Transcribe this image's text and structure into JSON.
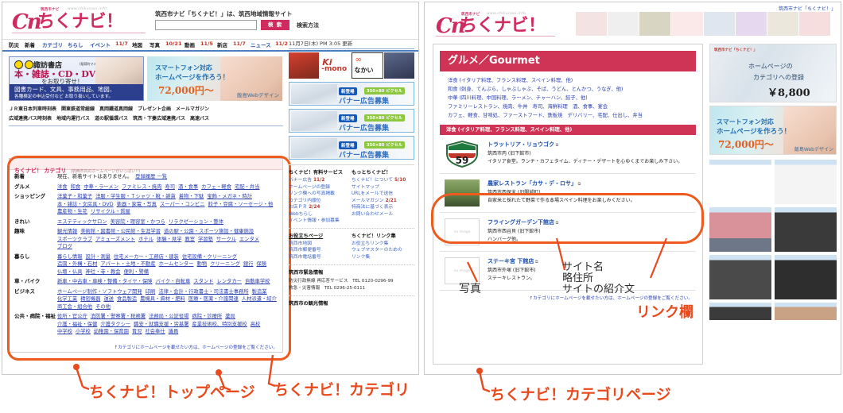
{
  "branding": {
    "logo_sub": "筑西市ナビ",
    "logo_url": "www.chikunavi.info",
    "logo_cn": "Cn",
    "logo_main": "ちくナビ！",
    "tagline": "筑西市ナビ「ちくナビ！」は、筑西地域情報サイト",
    "corner_tag": "筑西市ナビ「ちくナビ！」"
  },
  "search": {
    "value": "",
    "placeholder": "",
    "button": "検 索",
    "howto": "検索方法"
  },
  "nav": [
    {
      "label": "防災",
      "date": ""
    },
    {
      "label": "新着",
      "date": ""
    },
    {
      "label": "カテゴリ",
      "date": ""
    },
    {
      "label": "ちらし",
      "date": ""
    },
    {
      "label": "イベント",
      "date": "11/7"
    },
    {
      "label": "地図",
      "date": ""
    },
    {
      "label": "写真",
      "date": "10/21"
    },
    {
      "label": "動画",
      "date": "11/5"
    },
    {
      "label": "新店",
      "date": "11/7"
    },
    {
      "label": "ニュース",
      "date": "11/2"
    }
  ],
  "banners": {
    "left": {
      "shop": "諏訪書店",
      "shop_note": "(稲荷町マスゼン)",
      "line1": "本・雑誌・CD・DVD",
      "line2": "をお取り寄せ！",
      "line3": "図書カード、文具、事務用品、地図、",
      "line4": "各種検定の申込受付など お取り扱いしています。"
    },
    "right": {
      "line1": "スマートフォン対応",
      "line2": "ホームページを作ろう！",
      "price": "72,000円～",
      "credit": "飯島Webデザイン"
    }
  },
  "jr_links_row1": "ＪＲ東日本列車時刻表　関東鉄道常総線　真岡鐵道真岡線　プレゼント企画　メールマガジン",
  "jr_links_row2": "広域連携バス時刻表　地域内運行バス　道の駅循環バス　筑西・下妻広域連携バス　高速バス",
  "category_box": {
    "title": "ちくナビ！ カテゴリ",
    "title_note": "(筑西市内のホームページがいっぱい!!)",
    "footer": "↑カテゴリにホームページを載せたい方は、ホームページの登録をご覧ください。",
    "rows": [
      {
        "key": "新着",
        "lines": [
          [
            "現在、新着サイトはありません。",
            "登録履歴 一覧"
          ]
        ]
      },
      {
        "key": "グルメ",
        "lines": [
          [
            "洋食",
            "和食",
            "中華・ラーメン",
            "ファミレス・焼肉",
            "寿司",
            "酒・食事",
            "カフェ・軽食",
            "宅配・弁当"
          ]
        ]
      },
      {
        "key": "ショッピング",
        "lines": [
          [
            "洋菓子・和菓子",
            "洋服・学生服・Ｔシャツ・靴・雑貨",
            "着物・下駄",
            "宝飾・メガネ・時計"
          ],
          [
            "本・雑誌・文房具・DVD",
            "楽器・家電・写真",
            "スーパー・コンビニ",
            "餃子・豆腐・ソーセージ・他"
          ],
          [
            "農産物・生花",
            "リサイクル・質屋"
          ]
        ]
      },
      {
        "key": "きれい",
        "lines": [
          [
            "エステティックサロン",
            "美容院・理容室・かつら",
            "リラクゼーション・整体"
          ]
        ]
      },
      {
        "key": "趣味",
        "lines": [
          [
            "観光情報",
            "美術館・図書館・公民館・生涯学習",
            "道の駅・公園・スポーツ施設・健康施設"
          ],
          [
            "スポーツクラブ",
            "アミューズメント",
            "ホテル",
            "体験・見学",
            "教室",
            "学習塾",
            "サークル",
            "エンタメ"
          ],
          [
            "ブログ"
          ]
        ]
      },
      {
        "key": "暮らし",
        "lines": [
          [
            "暮らし情報",
            "設計・測量",
            "住宅メーカー・工務店・建装",
            "住宅設備・クリーニング"
          ],
          [
            "造園・外構・石材",
            "アパート・土地・不動産",
            "ホームセンター",
            "動物",
            "クリーニング",
            "銀行",
            "保険"
          ],
          [
            "仏壇・仏具",
            "神社・寺・教会",
            "便利・警備"
          ]
        ]
      },
      {
        "key": "車・バイク",
        "lines": [
          [
            "新車・中古車・車検・整備・タイヤ・保険",
            "バイク・自転車",
            "スタンド",
            "レンタカー",
            "自動車学校"
          ]
        ]
      },
      {
        "key": "ビジネス",
        "lines": [
          [
            "ホームページ制作・ソフトウェア開発",
            "印刷",
            "法律・会計・行政書士・司法書士事務所",
            "製造業"
          ],
          [
            "化学工業",
            "精密機器",
            "運送",
            "食品製造",
            "農機具・資材・肥料",
            "医療・医薬・介護関連",
            "人材派遣・紹介"
          ],
          [
            "商工会・組合他",
            "その他"
          ]
        ]
      },
      {
        "key": "公共・病院・福祉",
        "lines": [
          [
            "役所・官公庁",
            "消防署・警察署・税務署",
            "法務局・公証役場",
            "病院・診療所",
            "薬局"
          ],
          [
            "介護・福祉・保健",
            "介護タクシー",
            "職安・就職支援・労基署",
            "産業技術校、特別支援校",
            "高校"
          ],
          [
            "中学校",
            "小学校",
            "幼稚園・保育園",
            "育児",
            "社会奉仕",
            "議員"
          ]
        ]
      }
    ]
  },
  "left_sidebar": {
    "updated": "11月7日(木) PM 3:05 更新",
    "ad_banners": [
      {
        "new_tag": "新登場",
        "px_tag": "350×80 ピクセル",
        "text": "バナー広告募集"
      },
      {
        "new_tag": "新登場",
        "px_tag": "350×80 ピクセル",
        "text": "バナー広告募集"
      },
      {
        "new_tag": "新登場",
        "px_tag": "350×80 ピクセル",
        "text": "バナー広告募集"
      }
    ],
    "col_left": {
      "heading": "ちくナビ！有料サービス",
      "items": [
        {
          "label": "バナー広告",
          "date": "11/2"
        },
        {
          "label": "ホームページの登録",
          "date": ""
        },
        {
          "label": "リンク欄への写真掲載",
          "date": ""
        },
        {
          "label": "カテゴリ内順位",
          "date": ""
        },
        {
          "label": "お店ＰＲ",
          "date": "2/24"
        },
        {
          "label": "Webちらし",
          "date": ""
        },
        {
          "label": "イベント情報・参加募集",
          "date": ""
        }
      ]
    },
    "col_right": {
      "heading": "もっとちくナビ！",
      "items": [
        {
          "label": "ちくナビ！について",
          "date": "5/10"
        },
        {
          "label": "サイトマップ",
          "date": ""
        },
        {
          "label": "URLをメールで送信",
          "date": ""
        },
        {
          "label": "メールマガジン",
          "date": "2/21"
        },
        {
          "label": "特商法に基づく表示",
          "date": ""
        },
        {
          "label": "お問い合わせメール",
          "date": ""
        }
      ]
    },
    "col_left2": {
      "heading": "お役立ちページ",
      "items": [
        {
          "label": "筑西市地図",
          "date": ""
        },
        {
          "label": "筑西市郵便番号",
          "date": ""
        },
        {
          "label": "筑西市電話番号",
          "date": ""
        }
      ]
    },
    "col_right2": {
      "heading": "ちくナビ！リンク集",
      "items": [
        {
          "label": "お役立ちリンク集",
          "date": ""
        },
        {
          "label": "ウェブマスターのための",
          "date": ""
        },
        {
          "label": "リンク集",
          "date": ""
        }
      ]
    },
    "emergency": {
      "heading": "筑西市緊急情報",
      "line1": "防災行政無線 再応答サービス　TEL 0120-0296-99",
      "line2": "救急・災害情報　TEL 0296-25-0111"
    },
    "tourism_heading": "筑西市の観光情報"
  },
  "gourmet": {
    "title": "グルメ／Gourmet",
    "links": [
      "洋食 (イタリア料理、フランス料理、スペイン料理、他)",
      "和食 (刺身、てんぷら、しゃぶしゃぶ、そば、うどん、とんかつ、うなぎ、他)",
      "中華 (四川料理、中国料理、ラーメン、チャーハン、餃子、他)",
      "ファミリーレストラン、焼肉、牛丼　寿司、海鮮料理　酒、食事、宴会",
      "カフェ、軽食、甘味処、ファーストフード、鉄板焼　デリバリー、宅配、仕出し、弁当"
    ],
    "subheading": "洋食 (イタリア料理、フランス料理、スペイン料理、他)",
    "entries": [
      {
        "thumb": "shield",
        "name": "トラットリア・リョウゴク",
        "ext_icon": "external-link",
        "address": "筑西市丙 (旧下館市)",
        "desc": "イタリア食堂。ランチ・カフェタイム、ディナー・デザートを心ゆくまでお楽しみ下さい。"
      },
      {
        "thumb": "photo",
        "name": "農家レストラン「カサ・デ・ロサ」",
        "ext_icon": "external-link",
        "address": "筑西市西保末 (旧関城町)",
        "desc": "自家米と採れたて野菜で作る本場スペイン料理をお楽しみください。"
      },
      {
        "thumb": "noimage",
        "thumb_label": "no image",
        "name": "フライングガーデン下館店",
        "ext_icon": "external-link",
        "address": "筑西市西谷貝 (旧下館市)",
        "desc": "ハンバーグ他。"
      },
      {
        "thumb": "noimage",
        "thumb_label": "no image",
        "name": "ステーキ宮 下館店",
        "ext_icon": "external-link",
        "address": "筑西市外塚 (旧下館市)",
        "desc": "ステーキレストラン。"
      }
    ],
    "footer": "↑カテゴリにホームページを載せたい方は、ホームページの登録をご覧ください。"
  },
  "right_sidebar": {
    "ad1": {
      "tag": "筑西市ナビ「ちくナビ！」",
      "line1": "ホームページの",
      "line2": "カテゴリへの登録",
      "price": "￥8,800"
    },
    "ad2": {
      "line1": "スマートフォン対応",
      "line2": "ホームページを作ろう！",
      "price": "72,000円～",
      "credit": "飯島Webデザイン"
    }
  },
  "annotations": {
    "top_page": "ちくナビ！トップページ",
    "category": "ちくナビ！カテゴリ",
    "category_page": "ちくナビ！カテゴリページ",
    "photo": "写真",
    "site_name": "サイト名",
    "short_address": "略住所",
    "site_desc": "サイトの紹介文",
    "link_column": "リンク欄"
  },
  "colors": {
    "brand": "#cf2b5f",
    "accent": "#cf3457",
    "annotation": "#e8491d",
    "link": "#2a3fb0"
  }
}
